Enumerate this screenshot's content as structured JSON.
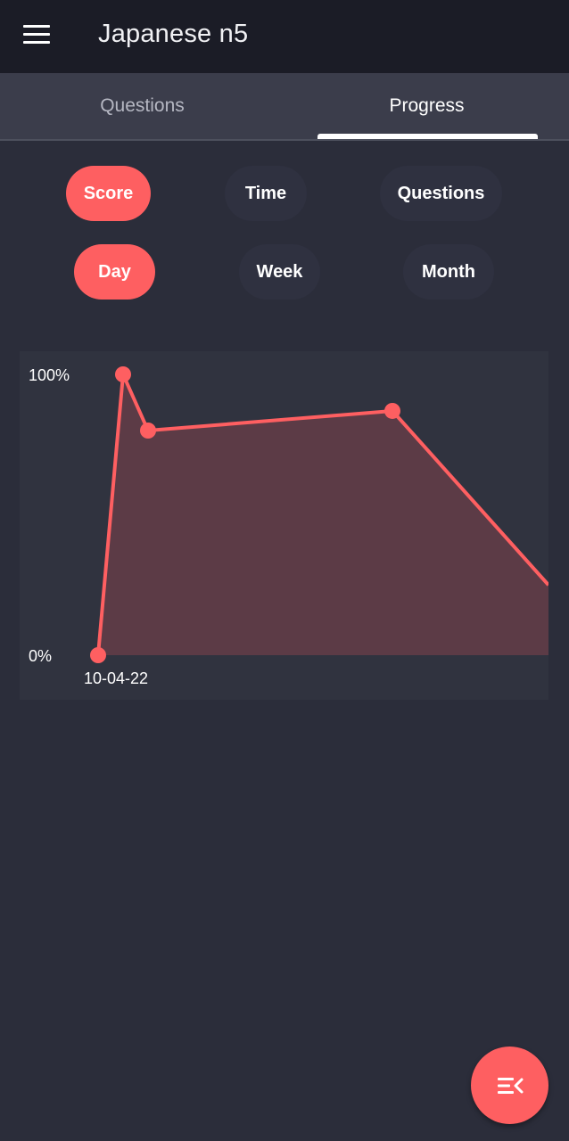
{
  "appbar": {
    "title": "Japanese n5",
    "menu_icon": "menu-icon"
  },
  "tabs": [
    {
      "label": "Questions",
      "active": false
    },
    {
      "label": "Progress",
      "active": true
    }
  ],
  "metric_filters": [
    {
      "label": "Score",
      "selected": true
    },
    {
      "label": "Time",
      "selected": false
    },
    {
      "label": "Questions",
      "selected": false
    }
  ],
  "period_filters": [
    {
      "label": "Day",
      "selected": true
    },
    {
      "label": "Week",
      "selected": false
    },
    {
      "label": "Month",
      "selected": false
    }
  ],
  "chart_data": {
    "type": "area",
    "y_labels": [
      "100%",
      "0%"
    ],
    "x_labels": [
      "10-04-22"
    ],
    "ylim": [
      0,
      100
    ],
    "values": [
      0,
      100,
      80,
      87,
      25
    ],
    "point_markers": [
      true,
      true,
      true,
      true,
      false
    ],
    "grid": false,
    "colors": {
      "line": "#fe5f61",
      "fill": "#5c3b46",
      "background": "#30333f"
    }
  },
  "fab": {
    "icon": "sort-collapse-icon"
  },
  "colors": {
    "accent": "#fe5f61",
    "background": "#2b2d3a",
    "appbar": "#1b1c26",
    "tabs": "#3b3d4b"
  }
}
